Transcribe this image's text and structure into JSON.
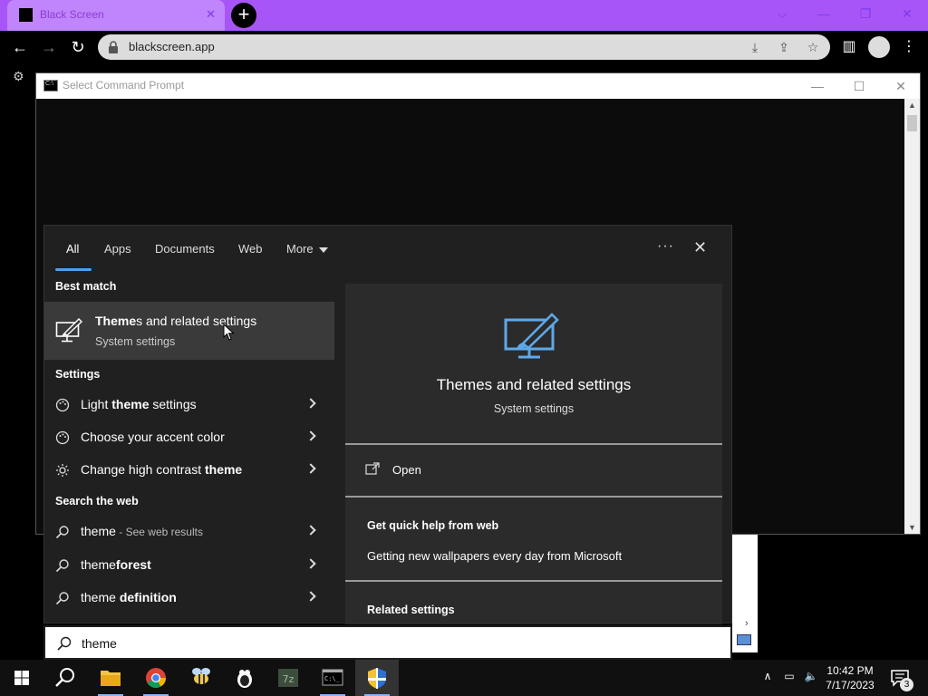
{
  "browser": {
    "tab_title": "Black Screen",
    "url": "blackscreen.app"
  },
  "cmd_window": {
    "title": "Select Command Prompt"
  },
  "search": {
    "filters": [
      {
        "label": "All"
      },
      {
        "label": "Apps"
      },
      {
        "label": "Documents"
      },
      {
        "label": "Web"
      },
      {
        "label": "More"
      }
    ],
    "best_match_heading": "Best match",
    "best_match": {
      "title_prefix": "Theme",
      "title_rest": "s and related settings",
      "subtitle": "System settings"
    },
    "settings_heading": "Settings",
    "settings_items": [
      {
        "pre": "Light ",
        "bold": "theme",
        "post": " settings"
      },
      {
        "pre": "Choose your accent color",
        "bold": "",
        "post": ""
      },
      {
        "pre": "Change high contrast ",
        "bold": "theme",
        "post": ""
      }
    ],
    "web_heading": "Search the web",
    "web_items": [
      {
        "pre": "theme",
        "bold": "",
        "post": "",
        "sub": " - See web results"
      },
      {
        "pre": "theme",
        "bold": "forest",
        "post": "",
        "sub": ""
      },
      {
        "pre": "theme ",
        "bold": "definition",
        "post": "",
        "sub": ""
      }
    ],
    "preview": {
      "title": "Themes and related settings",
      "subtitle": "System settings",
      "open_label": "Open",
      "help_heading": "Get quick help from web",
      "help_link": "Getting new wallpapers every day from Microsoft",
      "related_heading": "Related settings"
    },
    "query": "theme"
  },
  "taskbar": {
    "time": "10:42 PM",
    "date": "7/17/2023",
    "notification_count": "3"
  },
  "colors": {
    "accent": "#4aa1f5",
    "tab_bar": "#a855f7",
    "panel_bg": "#202020",
    "selected_bg": "#3a3a3a"
  }
}
